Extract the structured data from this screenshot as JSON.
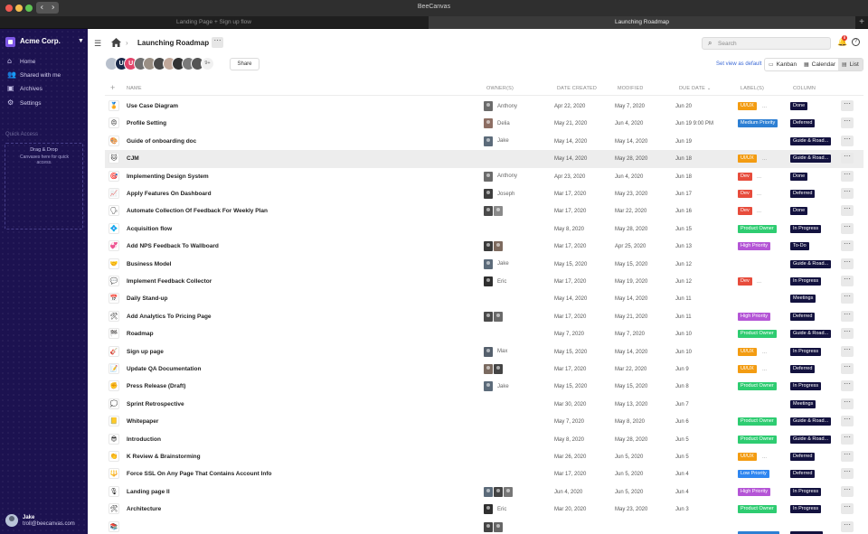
{
  "app": {
    "title": "BeeCanvas",
    "back_glyph": "‹",
    "forward_glyph": "›",
    "traffic_lights": [
      "#ee5a52",
      "#f4bd4f",
      "#5fc454"
    ]
  },
  "window_tabs": [
    {
      "label": "Landing Page + Sign up flow",
      "active": false
    },
    {
      "label": "Launching Roadmap",
      "active": true
    }
  ],
  "window_tab_plus": "+",
  "sidebar": {
    "workspace": "Acme Corp.",
    "caret": "▼",
    "items": [
      {
        "label": "Home",
        "icon": "home-icon",
        "glyph": "⌂"
      },
      {
        "label": "Shared with me",
        "icon": "people-icon",
        "glyph": "👥"
      },
      {
        "label": "Archives",
        "icon": "archive-icon",
        "glyph": "▣"
      },
      {
        "label": "Settings",
        "icon": "gear-icon",
        "glyph": "⚙"
      }
    ],
    "quick_access": {
      "title": "Quick Access",
      "heading": "Drag & Drop",
      "text": "Canvases here for quick access."
    },
    "user": {
      "name": "Jake",
      "email": "troll@beecanvas.com"
    }
  },
  "header": {
    "menu_glyph": "☰",
    "chevron": "›",
    "breadcrumb": "Launching Roadmap",
    "more_glyph": "···",
    "search_glyph": "⌕",
    "search_placeholder": "Search",
    "bell_glyph": "🔔",
    "notifications": "8",
    "help_glyph": "?",
    "share_label": "Share",
    "set_default_label": "Set view as default",
    "views": [
      {
        "label": "Kanban",
        "icon": "kanban-icon",
        "glyph": "▭",
        "selected": false
      },
      {
        "label": "Calendar",
        "icon": "calendar-icon",
        "glyph": "▦",
        "selected": false
      },
      {
        "label": "List",
        "icon": "list-icon",
        "glyph": "▤",
        "selected": true
      }
    ],
    "members": [
      {
        "initial": "",
        "color": "#b8c0cc"
      },
      {
        "initial": "U",
        "color": "#1b2a4a"
      },
      {
        "initial": "U",
        "color": "#e2456a"
      },
      {
        "initial": "",
        "color": "#6f6f6f"
      },
      {
        "initial": "",
        "color": "#9a8f84"
      },
      {
        "initial": "",
        "color": "#4a4a4a"
      },
      {
        "initial": "",
        "color": "#c1a89a"
      },
      {
        "initial": "",
        "color": "#333333"
      },
      {
        "initial": "",
        "color": "#7a7a7a"
      },
      {
        "initial": "",
        "color": "#555555"
      }
    ],
    "members_more": "9+"
  },
  "table": {
    "add_glyph": "+",
    "columns": {
      "name": "NAME",
      "owners": "OWNER(S)",
      "created": "DATE CREATED",
      "modified": "MODIFIED",
      "due": "DUE DATE",
      "due_sort": "⌄",
      "labels": "LABEL(S)",
      "column": "COLUMN"
    },
    "row_more_glyph": "···",
    "label_more_glyph": "...",
    "rows": [
      {
        "icon": "🏅",
        "name": "Use Case Diagram",
        "owners": [
          {
            "name": "Anthony",
            "color": "#6b6b6b"
          }
        ],
        "created": "Apr 22, 2020",
        "modified": "May 7, 2020",
        "due": "Jun 20",
        "label": "UI/UX",
        "label_color": "#f39c12",
        "label_more": true,
        "column": "Done"
      },
      {
        "icon": "😠",
        "name": "Profile Setting",
        "owners": [
          {
            "name": "Delia",
            "color": "#8d6e63"
          }
        ],
        "created": "May 21, 2020",
        "modified": "Jun 4, 2020",
        "due": "Jun 19 9:00 PM",
        "label": "Medium Priority",
        "label_color": "#2d7fd3",
        "label_more": false,
        "column": "Deferred"
      },
      {
        "icon": "🎨",
        "name": "Guide of onboarding doc",
        "owners": [
          {
            "name": "Jake",
            "color": "#5c6b7a"
          }
        ],
        "created": "May 14, 2020",
        "modified": "May 14, 2020",
        "due": "Jun 19",
        "label": "",
        "label_color": "",
        "label_more": false,
        "column": "Guide & Road..."
      },
      {
        "icon": "🐱",
        "name": "CJM",
        "owners": [],
        "created": "May 14, 2020",
        "modified": "May 28, 2020",
        "due": "Jun 18",
        "label": "UI/UX",
        "label_color": "#f39c12",
        "label_more": true,
        "column": "Guide & Road...",
        "highlight": true
      },
      {
        "icon": "🎯",
        "name": "Implementing Design System",
        "owners": [
          {
            "name": "Anthony",
            "color": "#6b6b6b"
          }
        ],
        "created": "Apr 23, 2020",
        "modified": "Jun 4, 2020",
        "due": "Jun 18",
        "label": "Dev",
        "label_color": "#e74c3c",
        "label_more": true,
        "column": "Done"
      },
      {
        "icon": "📈",
        "name": "Apply Features On Dashboard",
        "owners": [
          {
            "name": "Joseph",
            "color": "#3e3e3e"
          }
        ],
        "created": "Mar 17, 2020",
        "modified": "May 23, 2020",
        "due": "Jun 17",
        "label": "Dev",
        "label_color": "#e74c3c",
        "label_more": true,
        "column": "Deferred"
      },
      {
        "icon": "🗣",
        "name": "Automate Collection Of Feedback For Weekly Plan",
        "owners": [
          {
            "name": "",
            "color": "#4a4a4a"
          },
          {
            "name": "",
            "color": "#8a8a8a"
          }
        ],
        "created": "Mar 17, 2020",
        "modified": "Mar 22, 2020",
        "due": "Jun 16",
        "label": "Dev",
        "label_color": "#e74c3c",
        "label_more": true,
        "column": "Done"
      },
      {
        "icon": "💠",
        "name": "Acquisition flow",
        "owners": [],
        "created": "May 8, 2020",
        "modified": "May 28, 2020",
        "due": "Jun 15",
        "label": "Product Owner",
        "label_color": "#2ecc71",
        "label_more": false,
        "column": "In Progress"
      },
      {
        "icon": "💞",
        "name": "Add NPS Feedback To Wallboard",
        "owners": [
          {
            "name": "",
            "color": "#3a3a3a"
          },
          {
            "name": "",
            "color": "#7d6a5e"
          }
        ],
        "created": "Mar 17, 2020",
        "modified": "Apr 25, 2020",
        "due": "Jun 13",
        "label": "High Priority",
        "label_color": "#b455d6",
        "label_more": false,
        "column": "To-Do"
      },
      {
        "icon": "🤝",
        "name": "Business Model",
        "owners": [
          {
            "name": "Jake",
            "color": "#5c6b7a"
          }
        ],
        "created": "May 15, 2020",
        "modified": "May 15, 2020",
        "due": "Jun 12",
        "label": "",
        "label_color": "",
        "label_more": false,
        "column": "Guide & Road..."
      },
      {
        "icon": "💬",
        "name": "Implement Feedback Collector",
        "owners": [
          {
            "name": "Eric",
            "color": "#2f2f2f"
          }
        ],
        "created": "Mar 17, 2020",
        "modified": "May 19, 2020",
        "due": "Jun 12",
        "label": "Dev",
        "label_color": "#e74c3c",
        "label_more": true,
        "column": "In Progress"
      },
      {
        "icon": "📅",
        "name": "Daily Stand-up",
        "owners": [],
        "created": "May 14, 2020",
        "modified": "May 14, 2020",
        "due": "Jun 11",
        "label": "",
        "label_color": "",
        "label_more": false,
        "column": "Meetings"
      },
      {
        "icon": "🛠",
        "name": "Add Analytics To Pricing Page",
        "owners": [
          {
            "name": "",
            "color": "#4a4a4a"
          },
          {
            "name": "",
            "color": "#6a6a6a"
          }
        ],
        "created": "Mar 17, 2020",
        "modified": "May 21, 2020",
        "due": "Jun 11",
        "label": "High Priority",
        "label_color": "#b455d6",
        "label_more": false,
        "column": "Deferred"
      },
      {
        "icon": "🏁",
        "name": "Roadmap",
        "owners": [],
        "created": "May 7, 2020",
        "modified": "May 7, 2020",
        "due": "Jun 10",
        "label": "Product Owner",
        "label_color": "#2ecc71",
        "label_more": false,
        "column": "Guide & Road..."
      },
      {
        "icon": "🎸",
        "name": "Sign up page",
        "owners": [
          {
            "name": "Max",
            "color": "#55606d"
          }
        ],
        "created": "May 15, 2020",
        "modified": "May 14, 2020",
        "due": "Jun 10",
        "label": "UI/UX",
        "label_color": "#f39c12",
        "label_more": true,
        "column": "In Progress"
      },
      {
        "icon": "📝",
        "name": "Update QA Documentation",
        "owners": [
          {
            "name": "",
            "color": "#7a6a60"
          },
          {
            "name": "",
            "color": "#444444"
          }
        ],
        "created": "Mar 17, 2020",
        "modified": "Mar 22, 2020",
        "due": "Jun 9",
        "label": "UI/UX",
        "label_color": "#f39c12",
        "label_more": true,
        "column": "Deferred"
      },
      {
        "icon": "✊",
        "name": "Press Release (Draft)",
        "owners": [
          {
            "name": "Jake",
            "color": "#5c6b7a"
          }
        ],
        "created": "May 15, 2020",
        "modified": "May 15, 2020",
        "due": "Jun 8",
        "label": "Product Owner",
        "label_color": "#2ecc71",
        "label_more": false,
        "column": "In Progress"
      },
      {
        "icon": "💭",
        "name": "Sprint Retrospective",
        "owners": [],
        "created": "Mar 30, 2020",
        "modified": "May 13, 2020",
        "due": "Jun 7",
        "label": "",
        "label_color": "",
        "label_more": false,
        "column": "Meetings"
      },
      {
        "icon": "📒",
        "name": "Whitepaper",
        "owners": [],
        "created": "May 7, 2020",
        "modified": "May 8, 2020",
        "due": "Jun 6",
        "label": "Product Owner",
        "label_color": "#2ecc71",
        "label_more": false,
        "column": "Guide & Road..."
      },
      {
        "icon": "😎",
        "name": "Introduction",
        "owners": [],
        "created": "May 8, 2020",
        "modified": "May 28, 2020",
        "due": "Jun 5",
        "label": "Product Owner",
        "label_color": "#2ecc71",
        "label_more": false,
        "column": "Guide & Road..."
      },
      {
        "icon": "👏",
        "name": "K Review & Brainstorming",
        "owners": [],
        "created": "Mar 26, 2020",
        "modified": "Jun 5, 2020",
        "due": "Jun 5",
        "label": "UI/UX",
        "label_color": "#f39c12",
        "label_more": true,
        "column": "Deferred"
      },
      {
        "icon": "🔱",
        "name": "Force SSL On Any Page That Contains Account Info",
        "owners": [],
        "created": "Mar 17, 2020",
        "modified": "Jun 5, 2020",
        "due": "Jun 4",
        "label": "Low Priority",
        "label_color": "#2f86f0",
        "label_more": false,
        "column": "Deferred"
      },
      {
        "icon": "🎙",
        "name": "Landing page II",
        "owners": [
          {
            "name": "",
            "color": "#5c6b7a"
          },
          {
            "name": "",
            "color": "#444444"
          },
          {
            "name": "",
            "color": "#777777"
          }
        ],
        "created": "Jun 4, 2020",
        "modified": "Jun 5, 2020",
        "due": "Jun 4",
        "label": "High Priority",
        "label_color": "#b455d6",
        "label_more": false,
        "column": "In Progress"
      },
      {
        "icon": "🛠",
        "name": "Architecture",
        "owners": [
          {
            "name": "Eric",
            "color": "#2f2f2f"
          }
        ],
        "created": "Mar 20, 2020",
        "modified": "May 23, 2020",
        "due": "Jun 3",
        "label": "Product Owner",
        "label_color": "#2ecc71",
        "label_more": false,
        "column": "In Progress"
      },
      {
        "icon": "📚",
        "name": "",
        "owners": [
          {
            "name": "",
            "color": "#444444"
          },
          {
            "name": "",
            "color": "#666666"
          }
        ],
        "created": "",
        "modified": "",
        "due": "",
        "label": "",
        "label_color": "#2d7fd3",
        "label_more": false,
        "column": ""
      }
    ]
  }
}
